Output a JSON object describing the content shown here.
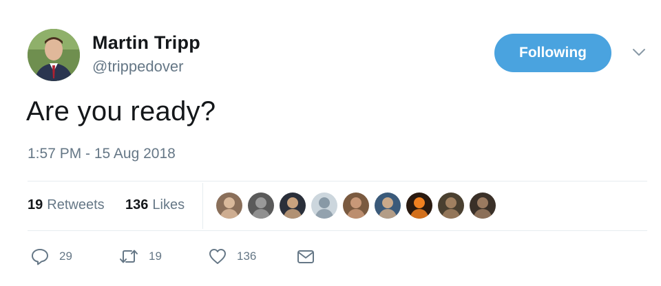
{
  "author": {
    "name": "Martin Tripp",
    "handle": "@trippedover"
  },
  "follow_button": {
    "label": "Following"
  },
  "tweet": {
    "text": "Are you ready?",
    "timestamp": "1:57 PM - 15 Aug 2018"
  },
  "stats": {
    "retweets_count": "19",
    "retweets_label": "Retweets",
    "likes_count": "136",
    "likes_label": "Likes"
  },
  "actions": {
    "reply_count": "29",
    "retweet_count": "19",
    "like_count": "136"
  },
  "icons": {
    "menu": "chevron-down-icon",
    "reply": "speech-bubble-icon",
    "retweet": "retweet-arrows-icon",
    "like": "heart-icon",
    "dm": "envelope-icon"
  },
  "colors": {
    "accent": "#4aa3df",
    "text_primary": "#14171a",
    "text_secondary": "#657786",
    "divider": "#e6ecf0"
  },
  "likers": [
    {
      "bg": "#8a6f5a",
      "fg": "#d9b99b"
    },
    {
      "bg": "#5a5a5a",
      "fg": "#9a9a9a"
    },
    {
      "bg": "#2a2f3a",
      "fg": "#c9a27e"
    },
    {
      "bg": "#ccd6dd",
      "fg": "#8899a6"
    },
    {
      "bg": "#7a5a40",
      "fg": "#c89878"
    },
    {
      "bg": "#3a5a7a",
      "fg": "#c9a98a"
    },
    {
      "bg": "#2a1a10",
      "fg": "#f08020"
    },
    {
      "bg": "#4a4030",
      "fg": "#a08060"
    },
    {
      "bg": "#3a3028",
      "fg": "#9a7a60"
    }
  ]
}
